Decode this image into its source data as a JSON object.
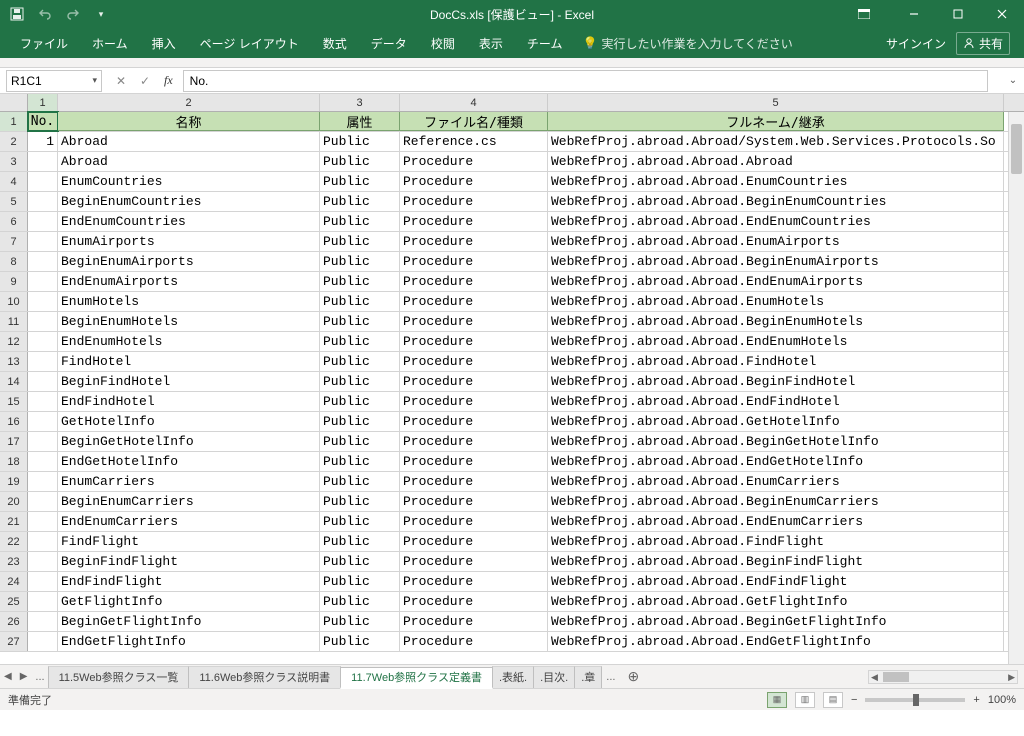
{
  "title": "DocCs.xls  [保護ビュー] - Excel",
  "ribbon": {
    "tabs": [
      "ファイル",
      "ホーム",
      "挿入",
      "ページ レイアウト",
      "数式",
      "データ",
      "校閲",
      "表示",
      "チーム"
    ],
    "tellme": "実行したい作業を入力してください",
    "signin": "サインイン",
    "share": "共有"
  },
  "namebox": "R1C1",
  "formula": "No.",
  "cols": [
    "1",
    "2",
    "3",
    "4",
    "5"
  ],
  "headers": {
    "c1": "No.",
    "c2": "名称",
    "c3": "属性",
    "c4": "ファイル名/種類",
    "c5": "フルネーム/継承"
  },
  "rows": [
    {
      "n": "1",
      "name": "Abroad",
      "attr": "Public",
      "type": "Reference.cs",
      "full": "WebRefProj.abroad.Abroad/System.Web.Services.Protocols.So"
    },
    {
      "n": "",
      "name": "Abroad",
      "attr": "Public",
      "type": "Procedure",
      "full": "WebRefProj.abroad.Abroad.Abroad"
    },
    {
      "n": "",
      "name": "EnumCountries",
      "attr": "Public",
      "type": "Procedure",
      "full": "WebRefProj.abroad.Abroad.EnumCountries"
    },
    {
      "n": "",
      "name": "BeginEnumCountries",
      "attr": "Public",
      "type": "Procedure",
      "full": "WebRefProj.abroad.Abroad.BeginEnumCountries"
    },
    {
      "n": "",
      "name": "EndEnumCountries",
      "attr": "Public",
      "type": "Procedure",
      "full": "WebRefProj.abroad.Abroad.EndEnumCountries"
    },
    {
      "n": "",
      "name": "EnumAirports",
      "attr": "Public",
      "type": "Procedure",
      "full": "WebRefProj.abroad.Abroad.EnumAirports"
    },
    {
      "n": "",
      "name": "BeginEnumAirports",
      "attr": "Public",
      "type": "Procedure",
      "full": "WebRefProj.abroad.Abroad.BeginEnumAirports"
    },
    {
      "n": "",
      "name": "EndEnumAirports",
      "attr": "Public",
      "type": "Procedure",
      "full": "WebRefProj.abroad.Abroad.EndEnumAirports"
    },
    {
      "n": "",
      "name": "EnumHotels",
      "attr": "Public",
      "type": "Procedure",
      "full": "WebRefProj.abroad.Abroad.EnumHotels"
    },
    {
      "n": "",
      "name": "BeginEnumHotels",
      "attr": "Public",
      "type": "Procedure",
      "full": "WebRefProj.abroad.Abroad.BeginEnumHotels"
    },
    {
      "n": "",
      "name": "EndEnumHotels",
      "attr": "Public",
      "type": "Procedure",
      "full": "WebRefProj.abroad.Abroad.EndEnumHotels"
    },
    {
      "n": "",
      "name": "FindHotel",
      "attr": "Public",
      "type": "Procedure",
      "full": "WebRefProj.abroad.Abroad.FindHotel"
    },
    {
      "n": "",
      "name": "BeginFindHotel",
      "attr": "Public",
      "type": "Procedure",
      "full": "WebRefProj.abroad.Abroad.BeginFindHotel"
    },
    {
      "n": "",
      "name": "EndFindHotel",
      "attr": "Public",
      "type": "Procedure",
      "full": "WebRefProj.abroad.Abroad.EndFindHotel"
    },
    {
      "n": "",
      "name": "GetHotelInfo",
      "attr": "Public",
      "type": "Procedure",
      "full": "WebRefProj.abroad.Abroad.GetHotelInfo"
    },
    {
      "n": "",
      "name": "BeginGetHotelInfo",
      "attr": "Public",
      "type": "Procedure",
      "full": "WebRefProj.abroad.Abroad.BeginGetHotelInfo"
    },
    {
      "n": "",
      "name": "EndGetHotelInfo",
      "attr": "Public",
      "type": "Procedure",
      "full": "WebRefProj.abroad.Abroad.EndGetHotelInfo"
    },
    {
      "n": "",
      "name": "EnumCarriers",
      "attr": "Public",
      "type": "Procedure",
      "full": "WebRefProj.abroad.Abroad.EnumCarriers"
    },
    {
      "n": "",
      "name": "BeginEnumCarriers",
      "attr": "Public",
      "type": "Procedure",
      "full": "WebRefProj.abroad.Abroad.BeginEnumCarriers"
    },
    {
      "n": "",
      "name": "EndEnumCarriers",
      "attr": "Public",
      "type": "Procedure",
      "full": "WebRefProj.abroad.Abroad.EndEnumCarriers"
    },
    {
      "n": "",
      "name": "FindFlight",
      "attr": "Public",
      "type": "Procedure",
      "full": "WebRefProj.abroad.Abroad.FindFlight"
    },
    {
      "n": "",
      "name": "BeginFindFlight",
      "attr": "Public",
      "type": "Procedure",
      "full": "WebRefProj.abroad.Abroad.BeginFindFlight"
    },
    {
      "n": "",
      "name": "EndFindFlight",
      "attr": "Public",
      "type": "Procedure",
      "full": "WebRefProj.abroad.Abroad.EndFindFlight"
    },
    {
      "n": "",
      "name": "GetFlightInfo",
      "attr": "Public",
      "type": "Procedure",
      "full": "WebRefProj.abroad.Abroad.GetFlightInfo"
    },
    {
      "n": "",
      "name": "BeginGetFlightInfo",
      "attr": "Public",
      "type": "Procedure",
      "full": "WebRefProj.abroad.Abroad.BeginGetFlightInfo"
    },
    {
      "n": "",
      "name": "EndGetFlightInfo",
      "attr": "Public",
      "type": "Procedure",
      "full": "WebRefProj.abroad.Abroad.EndGetFlightInfo"
    }
  ],
  "tabs": {
    "t1": "11.5Web参照クラス一覧",
    "t2": "11.6Web参照クラス説明書",
    "t3": "11.7Web参照クラス定義書",
    "t4": ".表紙.",
    "t5": ".目次.",
    "t6": ".章"
  },
  "status": {
    "ready": "準備完了",
    "zoom": "100%"
  }
}
